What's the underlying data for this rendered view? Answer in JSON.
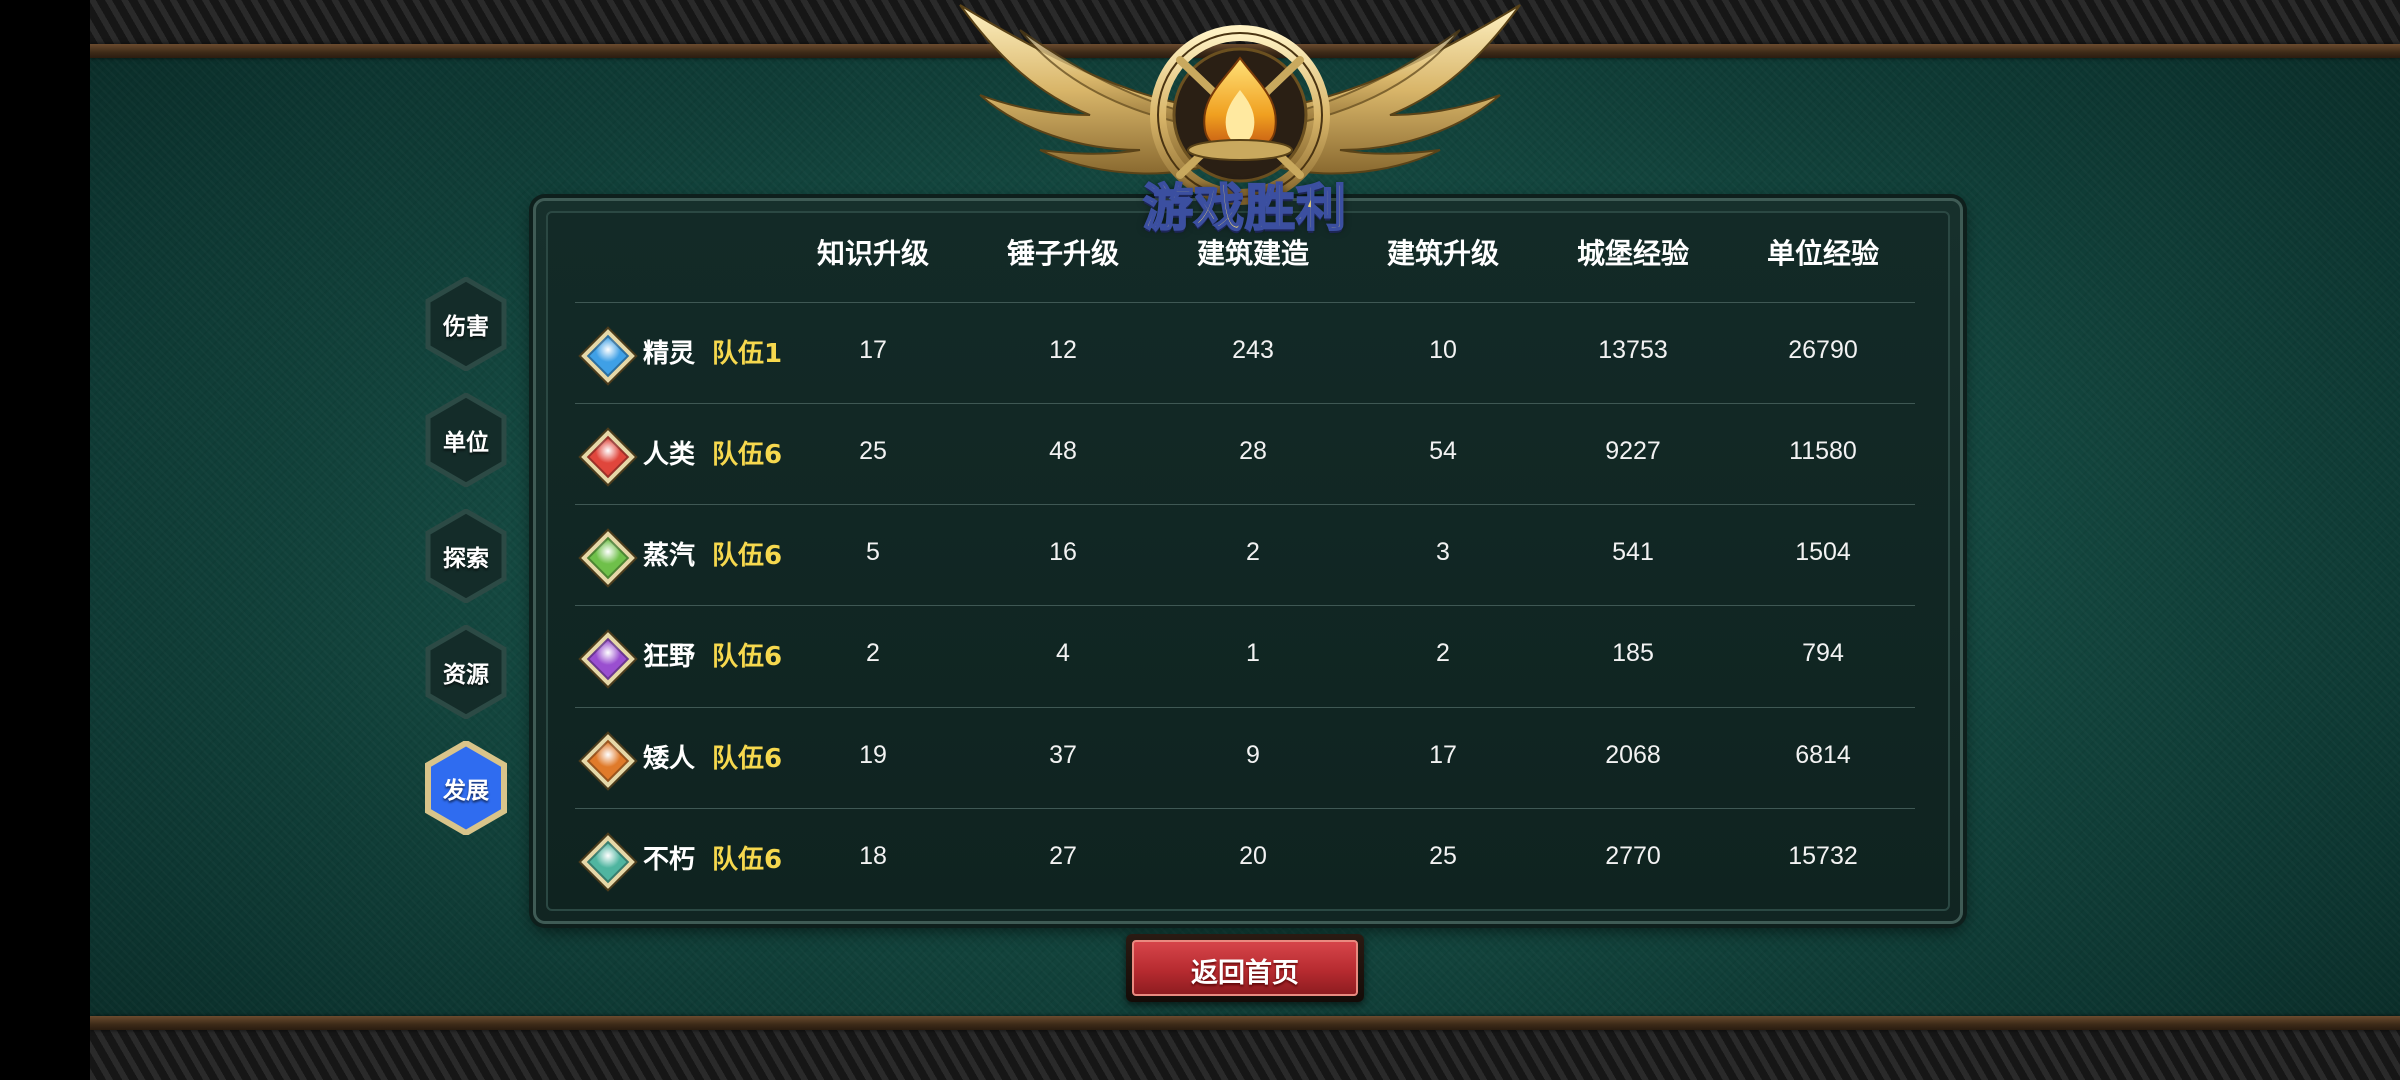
{
  "title": "游戏胜利",
  "columns": [
    "知识升级",
    "锤子升级",
    "建筑建造",
    "建筑升级",
    "城堡经验",
    "单位经验"
  ],
  "rows": [
    {
      "race": "精灵",
      "team": "队伍1",
      "gem_color": "#3fa0e6",
      "values": [
        "17",
        "12",
        "243",
        "10",
        "13753",
        "26790"
      ]
    },
    {
      "race": "人类",
      "team": "队伍6",
      "gem_color": "#e0463c",
      "values": [
        "25",
        "48",
        "28",
        "54",
        "9227",
        "11580"
      ]
    },
    {
      "race": "蒸汽",
      "team": "队伍6",
      "gem_color": "#6fc04a",
      "values": [
        "5",
        "16",
        "2",
        "3",
        "541",
        "1504"
      ]
    },
    {
      "race": "狂野",
      "team": "队伍6",
      "gem_color": "#9a4fd0",
      "values": [
        "2",
        "4",
        "1",
        "2",
        "185",
        "794"
      ]
    },
    {
      "race": "矮人",
      "team": "队伍6",
      "gem_color": "#e07a2a",
      "values": [
        "19",
        "37",
        "9",
        "17",
        "2068",
        "6814"
      ]
    },
    {
      "race": "不朽",
      "team": "队伍6",
      "gem_color": "#4fb5a0",
      "values": [
        "18",
        "27",
        "20",
        "25",
        "2770",
        "15732"
      ]
    }
  ],
  "tabs": [
    {
      "label": "伤害",
      "active": false
    },
    {
      "label": "单位",
      "active": false
    },
    {
      "label": "探索",
      "active": false
    },
    {
      "label": "资源",
      "active": false
    },
    {
      "label": "发展",
      "active": true
    }
  ],
  "back_button": "返回首页",
  "colors": {
    "team_text": "#f6d84e",
    "active_tab": "#2f6cf0",
    "button_red": "#c0343a"
  }
}
